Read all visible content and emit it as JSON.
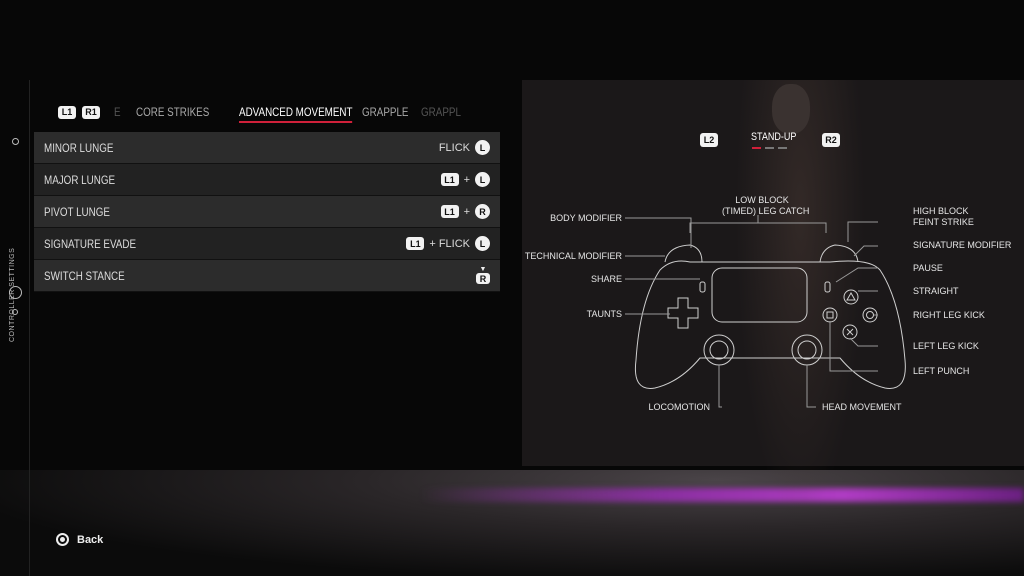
{
  "sidebar": {
    "title": "CONTROLLER SETTINGS"
  },
  "tabs": {
    "prev_button": "L1",
    "next_button": "R1",
    "items": [
      {
        "label": "E"
      },
      {
        "label": "CORE STRIKES"
      },
      {
        "label": "ADVANCED MOVEMENT",
        "active": true
      },
      {
        "label": "GRAPPLE"
      },
      {
        "label": "GRAPPL"
      }
    ]
  },
  "moves": [
    {
      "name": "MINOR LUNGE",
      "input": [
        "FLICK",
        "L"
      ]
    },
    {
      "name": "MAJOR LUNGE",
      "input": [
        "L1",
        "+",
        "L"
      ]
    },
    {
      "name": "PIVOT LUNGE",
      "input": [
        "L1",
        "+",
        "R"
      ]
    },
    {
      "name": "SIGNATURE EVADE",
      "input": [
        "L1",
        "+ FLICK",
        "L"
      ]
    },
    {
      "name": "SWITCH STANCE",
      "input": [
        "R"
      ]
    }
  ],
  "controller": {
    "mode": "STAND-UP",
    "prev": "L2",
    "next": "R2",
    "page_index": 1,
    "page_count": 3,
    "labels": {
      "body_modifier": "BODY MODIFIER",
      "technical_modifier": "TECHNICAL MODIFIER",
      "share": "SHARE",
      "taunts": "TAUNTS",
      "low_block": "LOW BLOCK",
      "leg_catch": "(TIMED) LEG CATCH",
      "high_block": "HIGH BLOCK",
      "feint_strike": "FEINT STRIKE",
      "signature_modifier": "SIGNATURE MODIFIER",
      "pause": "PAUSE",
      "straight": "STRAIGHT",
      "right_leg_kick": "RIGHT LEG KICK",
      "left_leg_kick": "LEFT LEG KICK",
      "left_punch": "LEFT PUNCH",
      "locomotion": "LOCOMOTION",
      "head_movement": "HEAD MOVEMENT"
    }
  },
  "footer": {
    "back_label": "Back"
  },
  "colors": {
    "accent": "#d0203a",
    "glow": "#b03cc4"
  }
}
